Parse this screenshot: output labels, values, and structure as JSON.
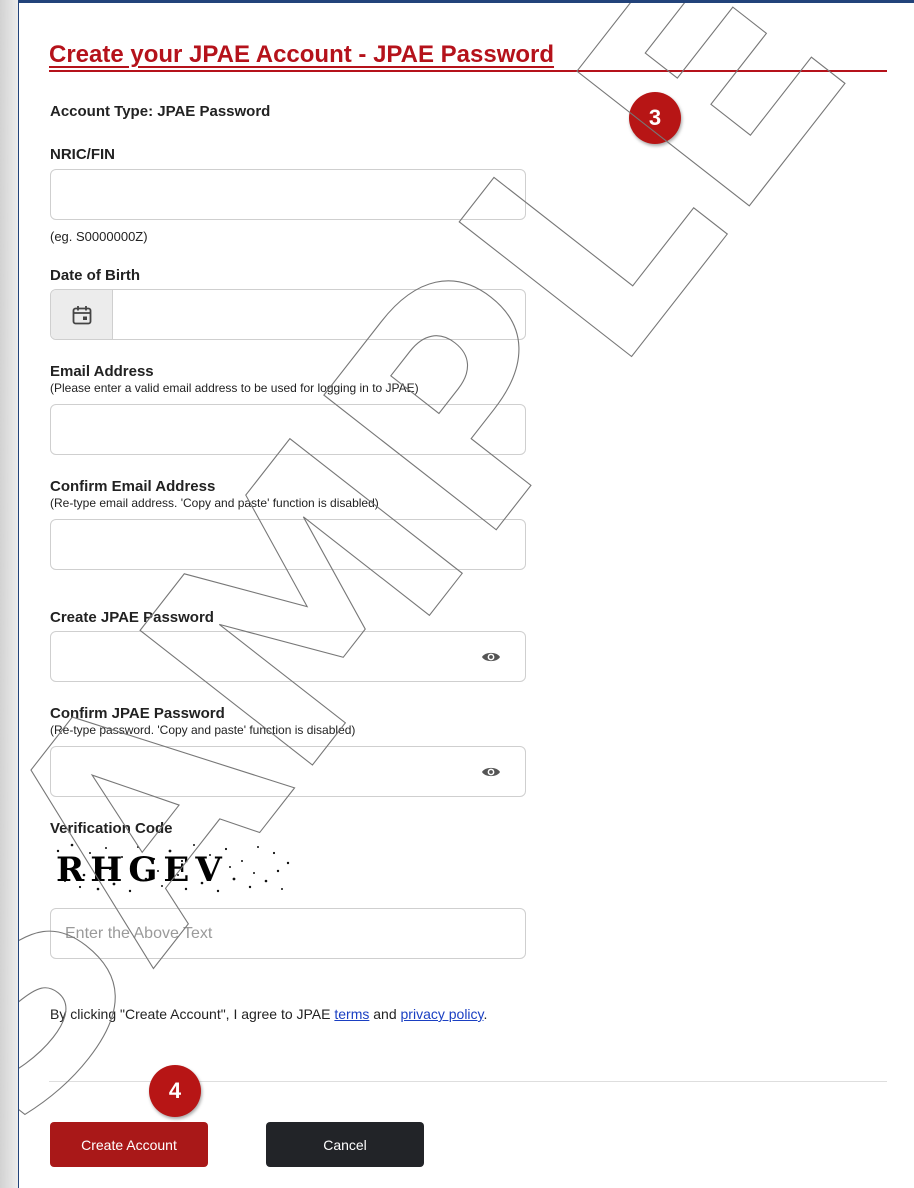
{
  "page_title": "Create your JPAE Account - JPAE Password",
  "account_type": "Account Type: JPAE Password",
  "badges": {
    "step3": "3",
    "step4": "4"
  },
  "nric": {
    "label": "NRIC/FIN",
    "value": "",
    "example": "(eg. S0000000Z)"
  },
  "dob": {
    "label": "Date of Birth",
    "value": "",
    "icon": "calendar-icon"
  },
  "email": {
    "label": "Email Address",
    "hint": "(Please enter a valid email address to be used for logging in to JPAE)",
    "value": ""
  },
  "confirm_email": {
    "label": "Confirm Email Address",
    "hint": "(Re-type email address. 'Copy and paste' function is disabled)",
    "value": ""
  },
  "password": {
    "label": "Create JPAE Password",
    "value": "",
    "icon": "eye-icon"
  },
  "confirm_password": {
    "label": "Confirm JPAE Password",
    "hint": "(Re-type password. 'Copy and paste' function is disabled)",
    "value": "",
    "icon": "eye-icon"
  },
  "verification": {
    "label": "Verification Code",
    "captcha_text": "RHGEV",
    "placeholder": "Enter the Above Text",
    "value": ""
  },
  "agreement": {
    "prefix": "By clicking \"Create Account\", I agree to JPAE ",
    "terms_link": "terms",
    "middle": " and ",
    "privacy_link": "privacy policy",
    "suffix": "."
  },
  "buttons": {
    "create": "Create Account",
    "cancel": "Cancel"
  },
  "watermark": "SAMPLE",
  "colors": {
    "brand_red": "#b5121b",
    "button_red": "#a91818",
    "button_dark": "#222428",
    "link_blue": "#1a3fc2",
    "frame_navy": "#22437a"
  }
}
